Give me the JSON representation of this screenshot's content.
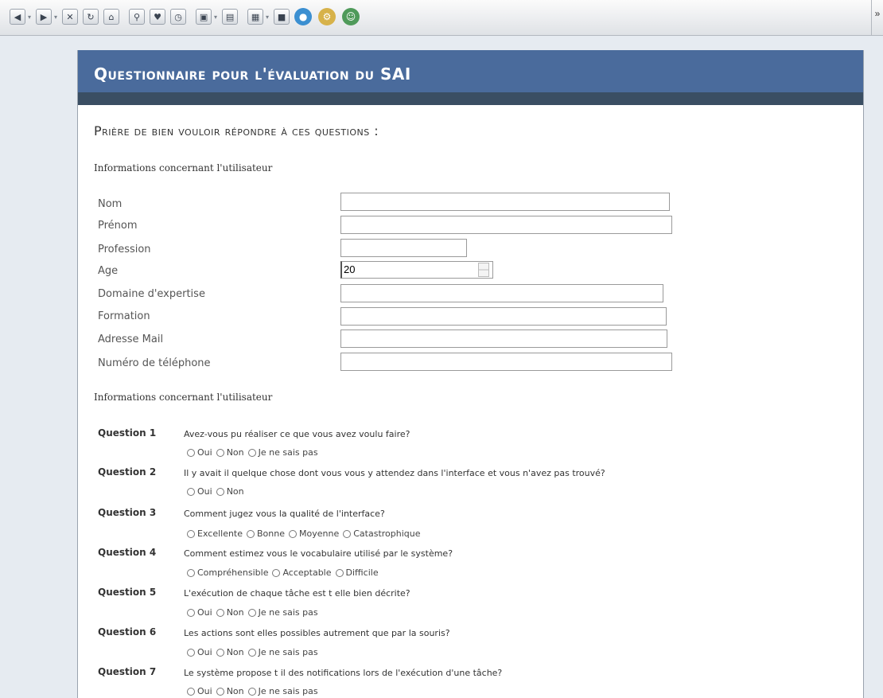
{
  "toolbar": {
    "icons": [
      "back-icon",
      "forward-icon",
      "stop-icon",
      "reload-icon",
      "home-icon",
      "search-icon",
      "bookmark-icon",
      "history-icon",
      "page-icon",
      "print-icon",
      "excel-icon",
      "chat-icon",
      "network-icon",
      "tools-icon",
      "users-icon"
    ],
    "right_glyph": "»"
  },
  "header": {
    "title": "Questionnaire pour l'évaluation du SAI"
  },
  "subtitle": "Prière de bien vouloir répondre à ces questions :",
  "section1": {
    "title": "Informations concernant l'utilisateur"
  },
  "fields": [
    {
      "label": "Nom"
    },
    {
      "label": "Prénom"
    },
    {
      "label": "Profession"
    },
    {
      "label": "Age",
      "value": "20"
    },
    {
      "label": "Domaine d'expertise"
    },
    {
      "label": "Formation"
    },
    {
      "label": "Adresse Mail"
    },
    {
      "label": "Numéro de téléphone"
    }
  ],
  "section2": {
    "title": "Informations concernant l'utilisateur"
  },
  "questions": [
    {
      "label": "Question 1",
      "text": "Avez-vous pu réaliser ce que vous avez voulu faire?",
      "options": [
        "Oui",
        "Non",
        "Je ne sais pas"
      ]
    },
    {
      "label": "Question 2",
      "text": "Il y avait il quelque chose dont vous vous y attendez dans l'interface et vous n'avez pas trouvé?",
      "options": [
        "Oui",
        "Non"
      ]
    },
    {
      "label": "Question 3",
      "text": "Comment jugez vous la qualité de l'interface?",
      "options": [
        "Excellente",
        "Bonne",
        "Moyenne",
        "Catastrophique"
      ]
    },
    {
      "label": "Question 4",
      "text": "Comment estimez vous le vocabulaire utilisé par le système?",
      "options": [
        "Compréhensible",
        "Acceptable",
        "Difficile"
      ]
    },
    {
      "label": "Question 5",
      "text": "L'exécution de chaque tâche est t elle bien décrite?",
      "options": [
        "Oui",
        "Non",
        "Je ne sais pas"
      ]
    },
    {
      "label": "Question 6",
      "text": "Les actions sont elles possibles autrement que par la souris?",
      "options": [
        "Oui",
        "Non",
        "Je ne sais pas"
      ]
    },
    {
      "label": "Question 7",
      "text": "Le système propose t il des notifications lors de l'exécution d'une tâche?",
      "options": [
        "Oui",
        "Non",
        "Je ne sais pas"
      ]
    }
  ]
}
